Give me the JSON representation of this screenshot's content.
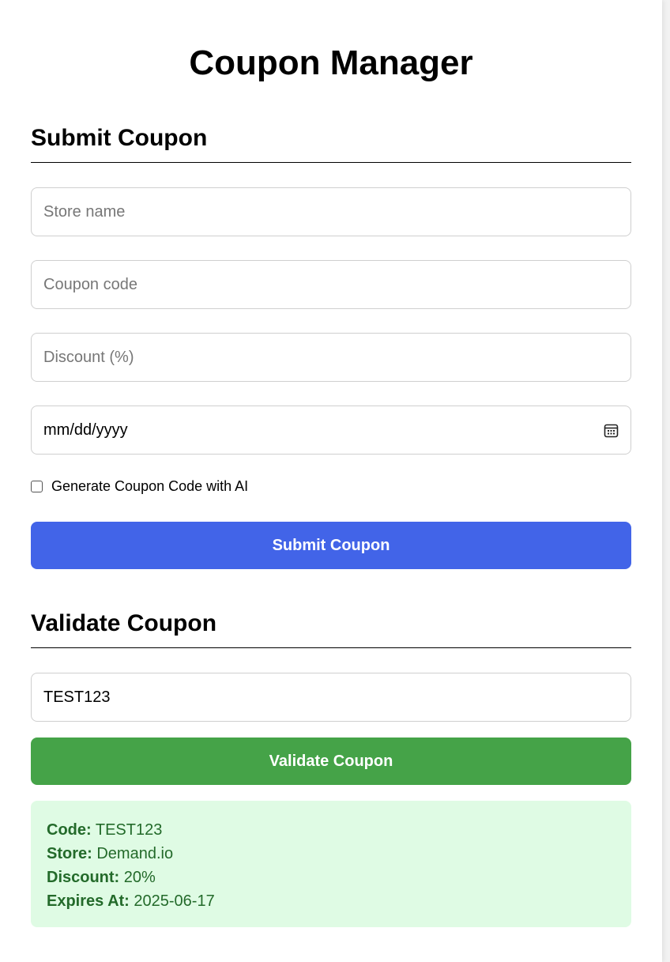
{
  "app": {
    "title": "Coupon Manager"
  },
  "submit_section": {
    "title": "Submit Coupon",
    "store_placeholder": "Store name",
    "store_value": "",
    "code_placeholder": "Coupon code",
    "code_value": "",
    "discount_placeholder": "Discount (%)",
    "discount_value": "",
    "date_placeholder": "mm/dd/yyyy",
    "calendar_icon": "calendar-icon",
    "ai_checkbox_label": "Generate Coupon Code with AI",
    "ai_checkbox_checked": false,
    "submit_button_label": "Submit Coupon"
  },
  "validate_section": {
    "title": "Validate Coupon",
    "code_value": "TEST123",
    "validate_button_label": "Validate Coupon"
  },
  "result": {
    "code_label": "Code:",
    "code_value": "TEST123",
    "store_label": "Store:",
    "store_value": "Demand.io",
    "discount_label": "Discount:",
    "discount_value": "20%",
    "expires_label": "Expires At:",
    "expires_value": "2025-06-17"
  },
  "colors": {
    "submit_button": "#4264e8",
    "validate_button": "#45a348",
    "result_bg": "#dffbe4",
    "result_text": "#236a2a"
  }
}
